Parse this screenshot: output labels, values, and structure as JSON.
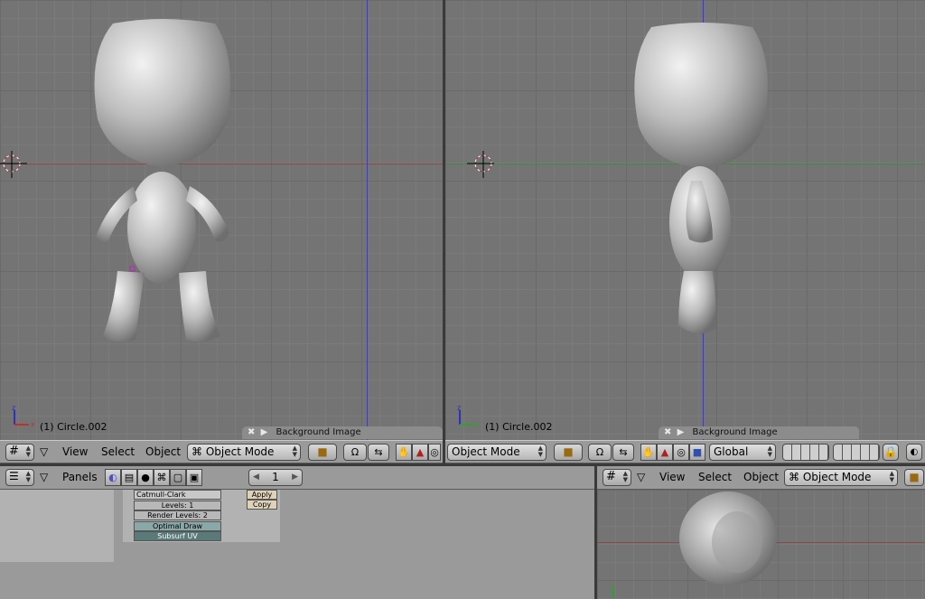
{
  "colors": {
    "grid_bg": "#747474",
    "header_bg": "#9a9a9a",
    "axis_red": "#8a3a3a",
    "axis_blue": "#3a3aa8",
    "axis_green": "#3f8a3f"
  },
  "viewport_left": {
    "object_label": "(1) Circle.002",
    "bg_image_label": "Background Image"
  },
  "viewport_right": {
    "object_label": "(1) Circle.002",
    "bg_image_label": "Background Image"
  },
  "header_left": {
    "view": "View",
    "select": "Select",
    "object": "Object",
    "mode": "Object Mode"
  },
  "header_right": {
    "mode": "Object Mode",
    "transform": "Global"
  },
  "buttons_header": {
    "panels": "Panels",
    "frame": "1"
  },
  "modifier": {
    "type": "Catmull-Clark",
    "levels": "Levels: 1",
    "render_levels": "Render Levels: 2",
    "optimal_draw": "Optimal Draw",
    "subsurf_uv": "Subsurf UV",
    "apply": "Apply",
    "copy": "Copy"
  },
  "header_bottom_right": {
    "view": "View",
    "select": "Select",
    "object": "Object",
    "mode": "Object Mode"
  }
}
